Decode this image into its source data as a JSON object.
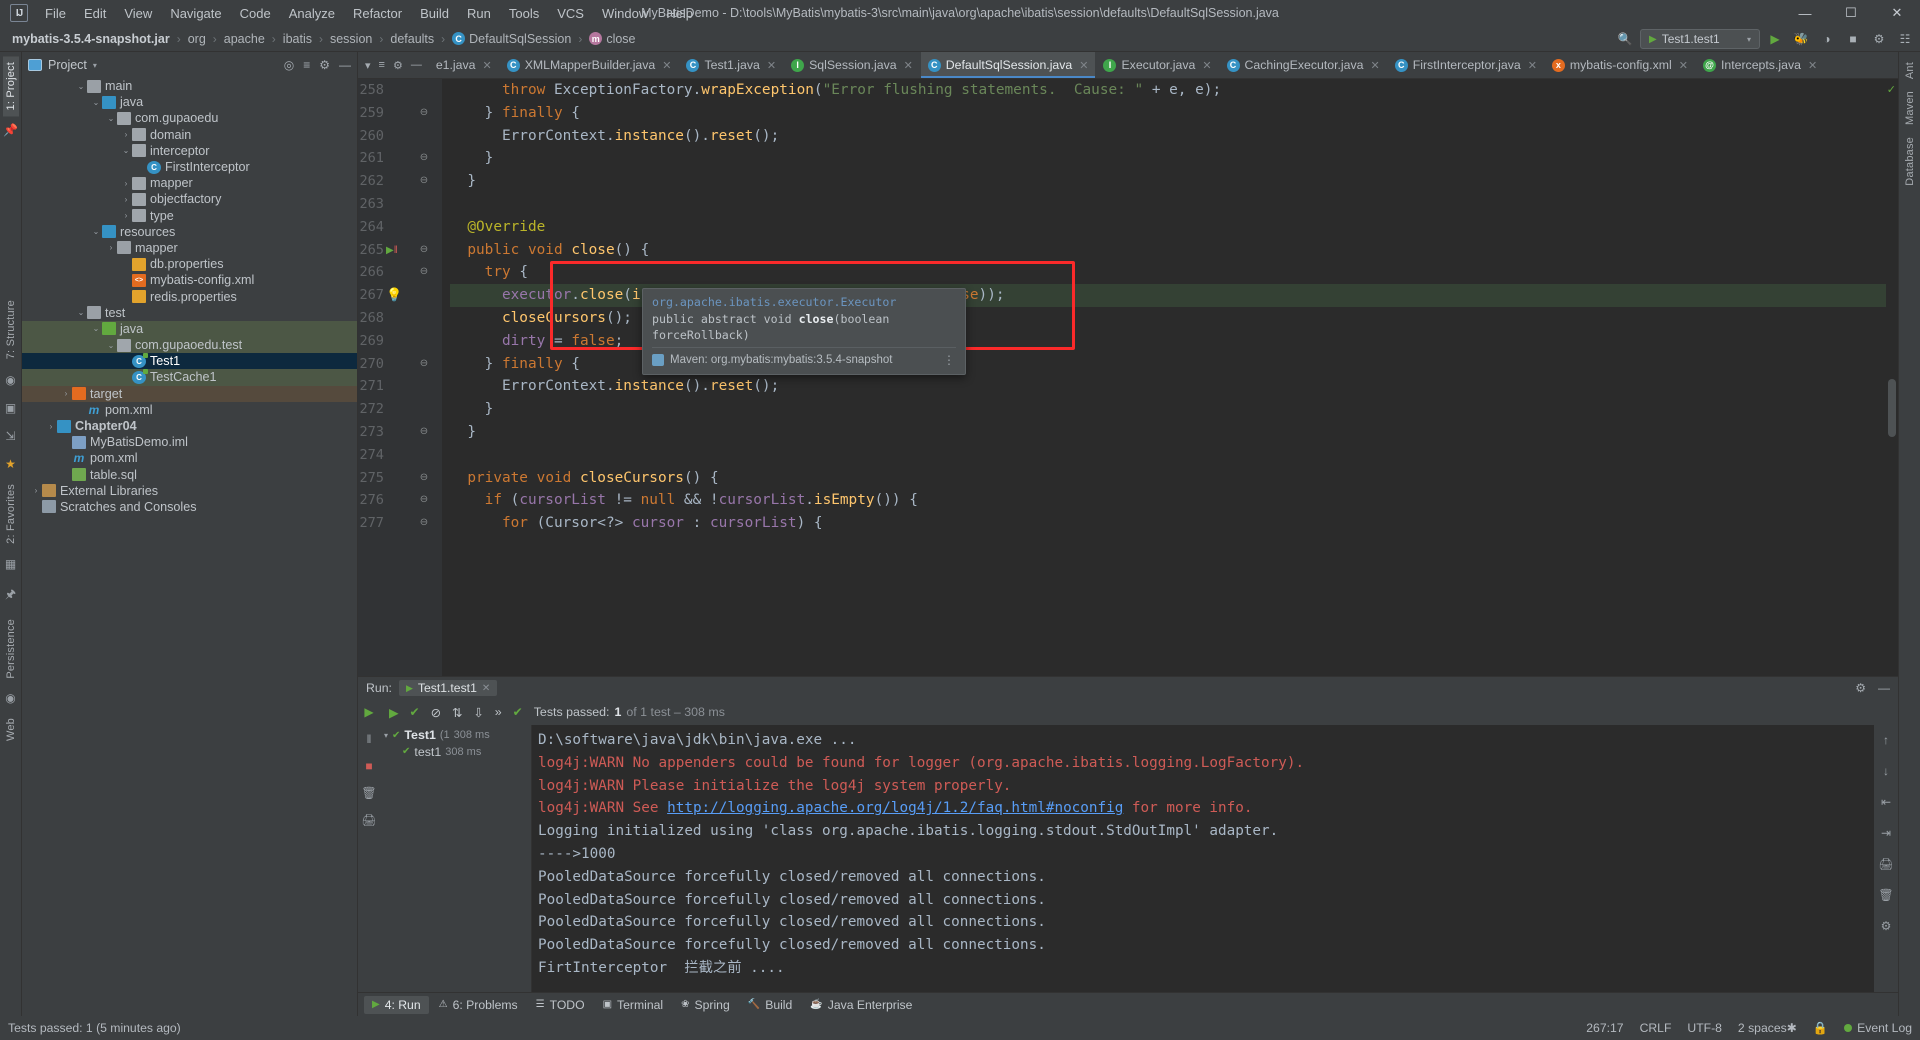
{
  "window": {
    "title": "MyBatisDemo - D:\\tools\\MyBatis\\mybatis-3\\src\\main\\java\\org\\apache\\ibatis\\session\\defaults\\DefaultSqlSession.java",
    "logo": "IJ",
    "minimize": "—",
    "maximize": "☐",
    "close": "✕"
  },
  "menu": {
    "items": [
      "File",
      "Edit",
      "View",
      "Navigate",
      "Code",
      "Analyze",
      "Refactor",
      "Build",
      "Run",
      "Tools",
      "VCS",
      "Window",
      "Help"
    ]
  },
  "navbar": {
    "crumbs": [
      {
        "label": "mybatis-3.5.4-snapshot.jar",
        "icon": ""
      },
      {
        "label": "org",
        "icon": ""
      },
      {
        "label": "apache",
        "icon": ""
      },
      {
        "label": "ibatis",
        "icon": ""
      },
      {
        "label": "session",
        "icon": ""
      },
      {
        "label": "defaults",
        "icon": ""
      },
      {
        "label": "DefaultSqlSession",
        "icon": "class-icon"
      },
      {
        "label": "close",
        "icon": "method-icon"
      }
    ],
    "separator": "›",
    "run_config": "Test1.test1",
    "search_icon": "search-icon",
    "run_icon": "▶",
    "debug_icon": "🐞",
    "coverage_icon": "◑",
    "stop_icon": "■",
    "settings_icon": "⚙",
    "layout_icon": "☷"
  },
  "left_strip": {
    "project_tab": "1: Project",
    "structure_tab": "7: Structure",
    "favorites_tab": "2: Favorites",
    "persistence_tab": "Persistence",
    "web_tab": "Web",
    "icons": [
      "pin-icon",
      "camera-icon",
      "database-icon",
      "export-icon",
      "star-icon",
      "grid-icon",
      "pin2-icon",
      "globe-icon"
    ]
  },
  "right_strip": {
    "tabs": [
      "Ant",
      "Maven",
      "Database"
    ]
  },
  "project_panel": {
    "title": "Project",
    "caret": "▾",
    "tools": [
      "target-icon",
      "collapse-icon",
      "gear-icon",
      "hide-icon"
    ],
    "tree": [
      {
        "indent": 3,
        "arrow": "⌄",
        "icon": "folder",
        "label": "main",
        "state": "normal"
      },
      {
        "indent": 4,
        "arrow": "⌄",
        "icon": "folder-blue",
        "label": "java",
        "state": "normal"
      },
      {
        "indent": 5,
        "arrow": "⌄",
        "icon": "pkg",
        "label": "com.gupaoedu",
        "state": "normal"
      },
      {
        "indent": 6,
        "arrow": "›",
        "icon": "pkg",
        "label": "domain",
        "state": "normal"
      },
      {
        "indent": 6,
        "arrow": "⌄",
        "icon": "pkg",
        "label": "interceptor",
        "state": "normal"
      },
      {
        "indent": 7,
        "arrow": "",
        "icon": "class",
        "label": "FirstInterceptor",
        "state": "normal"
      },
      {
        "indent": 6,
        "arrow": "›",
        "icon": "pkg",
        "label": "mapper",
        "state": "normal"
      },
      {
        "indent": 6,
        "arrow": "›",
        "icon": "pkg",
        "label": "objectfactory",
        "state": "normal"
      },
      {
        "indent": 6,
        "arrow": "›",
        "icon": "pkg",
        "label": "type",
        "state": "normal"
      },
      {
        "indent": 4,
        "arrow": "⌄",
        "icon": "folder-res",
        "label": "resources",
        "state": "normal"
      },
      {
        "indent": 5,
        "arrow": "›",
        "icon": "folder",
        "label": "mapper",
        "state": "normal"
      },
      {
        "indent": 6,
        "arrow": "",
        "icon": "prop",
        "label": "db.properties",
        "state": "normal"
      },
      {
        "indent": 6,
        "arrow": "",
        "icon": "xml",
        "label": "mybatis-config.xml",
        "state": "normal"
      },
      {
        "indent": 6,
        "arrow": "",
        "icon": "prop",
        "label": "redis.properties",
        "state": "normal"
      },
      {
        "indent": 3,
        "arrow": "⌄",
        "icon": "folder",
        "label": "test",
        "state": "normal"
      },
      {
        "indent": 4,
        "arrow": "⌄",
        "icon": "folder-green",
        "label": "java",
        "state": "testsrc"
      },
      {
        "indent": 5,
        "arrow": "⌄",
        "icon": "pkg",
        "label": "com.gupaoedu.test",
        "state": "testsrc"
      },
      {
        "indent": 6,
        "arrow": "",
        "icon": "test",
        "label": "Test1",
        "state": "sel"
      },
      {
        "indent": 6,
        "arrow": "",
        "icon": "test",
        "label": "TestCache1",
        "state": "testsrc"
      },
      {
        "indent": 2,
        "arrow": "›",
        "icon": "folder-orange",
        "label": "target",
        "state": "targetdir"
      },
      {
        "indent": 3,
        "arrow": "",
        "icon": "maven",
        "label": "pom.xml",
        "state": "normal"
      },
      {
        "indent": 1,
        "arrow": "›",
        "icon": "folder-blue",
        "label": "Chapter04",
        "state": "bold"
      },
      {
        "indent": 2,
        "arrow": "",
        "icon": "iml",
        "label": "MyBatisDemo.iml",
        "state": "normal"
      },
      {
        "indent": 2,
        "arrow": "",
        "icon": "maven",
        "label": "pom.xml",
        "state": "normal"
      },
      {
        "indent": 2,
        "arrow": "",
        "icon": "sql",
        "label": "table.sql",
        "state": "normal"
      },
      {
        "indent": 0,
        "arrow": "›",
        "icon": "lib",
        "label": "External Libraries",
        "state": "normal"
      },
      {
        "indent": 0,
        "arrow": "",
        "icon": "scratch",
        "label": "Scratches and Consoles",
        "state": "normal"
      }
    ]
  },
  "editor": {
    "tabs": [
      {
        "label": "e1.java",
        "icon": "class-icon",
        "active": false,
        "partial": true
      },
      {
        "label": "XMLMapperBuilder.java",
        "icon": "class-icon",
        "active": false
      },
      {
        "label": "Test1.java",
        "icon": "test-icon",
        "active": false
      },
      {
        "label": "SqlSession.java",
        "icon": "interface-icon",
        "active": false
      },
      {
        "label": "DefaultSqlSession.java",
        "icon": "class-icon",
        "active": true
      },
      {
        "label": "Executor.java",
        "icon": "interface-icon",
        "active": false
      },
      {
        "label": "CachingExecutor.java",
        "icon": "class-icon",
        "active": false
      },
      {
        "label": "FirstInterceptor.java",
        "icon": "class-icon",
        "active": false
      },
      {
        "label": "mybatis-config.xml",
        "icon": "xml-icon",
        "active": false
      },
      {
        "label": "Intercepts.java",
        "icon": "annotation-icon",
        "active": false
      }
    ],
    "close_glyph": "✕",
    "lead_icons": [
      "chevron-down-icon",
      "sort-icon",
      "gear-icon",
      "minimize-icon"
    ],
    "lines": [
      {
        "n": 258,
        "text": "      throw ExceptionFactory.wrapException(\"Error flushing statements.  Cause: \" + e, e);"
      },
      {
        "n": 259,
        "text": "    } finally {",
        "fold": "⊖"
      },
      {
        "n": 260,
        "text": "      ErrorContext.instance().reset();"
      },
      {
        "n": 261,
        "text": "    }",
        "fold": "⊖"
      },
      {
        "n": 262,
        "text": "  }",
        "fold": "⊖"
      },
      {
        "n": 263,
        "text": ""
      },
      {
        "n": 264,
        "text": "  @Override"
      },
      {
        "n": 265,
        "text": "  public void close() {",
        "fold": "⊖",
        "gutter": "run-test-icon"
      },
      {
        "n": 266,
        "text": "    try {",
        "fold": "⊖"
      },
      {
        "n": 267,
        "text": "      executor.close(isCommitOrRollbackRequired( force: false));",
        "gutter": "bulb-icon",
        "current": true
      },
      {
        "n": 268,
        "text": "      closeCursors();"
      },
      {
        "n": 269,
        "text": "      dirty = false;"
      },
      {
        "n": 270,
        "text": "    } finally {",
        "fold": "⊖"
      },
      {
        "n": 271,
        "text": "      ErrorContext.instance().reset();"
      },
      {
        "n": 272,
        "text": "    }"
      },
      {
        "n": 273,
        "text": "  }",
        "fold": "⊖"
      },
      {
        "n": 274,
        "text": ""
      },
      {
        "n": 275,
        "text": "  private void closeCursors() {",
        "fold": "⊖"
      },
      {
        "n": 276,
        "text": "    if (cursorList != null && !cursorList.isEmpty()) {",
        "fold": "⊖"
      },
      {
        "n": 277,
        "text": "      for (Cursor<?> cursor : cursorList) {",
        "fold": "⊖"
      }
    ],
    "tooltip": {
      "package": "org.apache.ibatis.executor.Executor",
      "signature_pre": "public abstract void ",
      "signature_name": "close",
      "signature_post": "(boolean forceRollback)",
      "maven": "Maven: org.mybatis:mybatis:3.5.4-snapshot",
      "maven_icon": "maven-icon",
      "more": "⋮"
    }
  },
  "run_panel": {
    "label": "Run:",
    "tab": "Test1.test1",
    "tab_icon": "run-config-icon",
    "close_glyph": "✕",
    "header_right": [
      "gear-icon",
      "minimize-icon"
    ],
    "toolbar_icons": [
      "rerun-icon",
      "check-icon",
      "filter-icon",
      "sort-icon",
      "sort-duration-icon",
      "expand-icon"
    ],
    "status_check": "✔",
    "status_prefix": "Tests passed:",
    "status_count": "1",
    "status_suffix": "of 1 test – 308 ms",
    "left_icons": [
      "run-icon",
      "pause-icon",
      "stop-icon",
      "trash-icon",
      "print-icon"
    ],
    "tests_tree": [
      {
        "indent": 0,
        "arrow": "⌄",
        "icon": "test-ok-icon",
        "label": "Test1",
        "time": "308 ms",
        "extra": "(1"
      },
      {
        "indent": 1,
        "arrow": "",
        "icon": "test-ok-icon",
        "label": "test1",
        "time": "308 ms"
      }
    ],
    "console": [
      {
        "text": "D:\\software\\java\\jdk\\bin\\java.exe ...",
        "style": "cmd"
      },
      {
        "text": "log4j:WARN No appenders could be found for logger (org.apache.ibatis.logging.LogFactory).",
        "style": "warn"
      },
      {
        "text": "log4j:WARN Please initialize the log4j system properly.",
        "style": "warn"
      },
      {
        "text": "log4j:WARN See ",
        "style": "warn",
        "link": "http://logging.apache.org/log4j/1.2/faq.html#noconfig",
        "after": " for more info."
      },
      {
        "text": "Logging initialized using 'class org.apache.ibatis.logging.stdout.StdOutImpl' adapter.",
        "style": "normal"
      },
      {
        "text": "---->1000",
        "style": "normal"
      },
      {
        "text": "PooledDataSource forcefully closed/removed all connections.",
        "style": "normal"
      },
      {
        "text": "PooledDataSource forcefully closed/removed all connections.",
        "style": "normal"
      },
      {
        "text": "PooledDataSource forcefully closed/removed all connections.",
        "style": "normal"
      },
      {
        "text": "PooledDataSource forcefully closed/removed all connections.",
        "style": "normal"
      },
      {
        "text": "FirtInterceptor  拦截之前 ....",
        "style": "normal"
      }
    ],
    "console_right_icons": [
      "up-icon",
      "down-icon",
      "wrap-icon",
      "print-icon",
      "trash-icon"
    ]
  },
  "toolwindow_bar": {
    "items": [
      {
        "label": "4: Run",
        "icon": "▶",
        "active": true
      },
      {
        "label": "6: Problems",
        "icon": "⚠",
        "active": false
      },
      {
        "label": "TODO",
        "icon": "☰",
        "active": false
      },
      {
        "label": "Terminal",
        "icon": "▣",
        "active": false
      },
      {
        "label": "Spring",
        "icon": "❀",
        "active": false
      },
      {
        "label": "Build",
        "icon": "🔨",
        "active": false
      },
      {
        "label": "Java Enterprise",
        "icon": "☕",
        "active": false
      }
    ]
  },
  "statusbar": {
    "message": "Tests passed: 1 (5 minutes ago)",
    "caret": "267:17",
    "line_sep": "CRLF",
    "encoding": "UTF-8",
    "indent": "2 spaces",
    "indent_mark": "✱",
    "lock_icon": "🔒",
    "event_log": "Event Log",
    "event_dot": "event-dot-icon"
  }
}
